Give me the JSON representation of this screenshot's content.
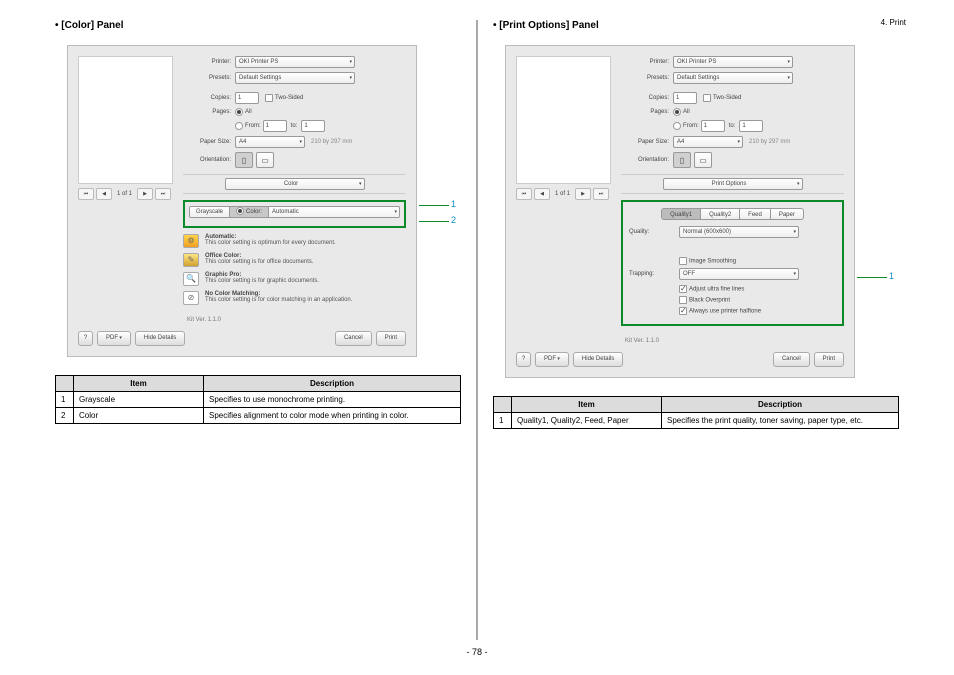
{
  "header": {
    "chapter": "4. Print"
  },
  "page_number": "- 78 -",
  "left": {
    "title": "[Color] Panel",
    "dialog": {
      "printer_label": "Printer:",
      "printer_value": "OKI Printer PS",
      "presets_label": "Presets:",
      "presets_value": "Default Settings",
      "copies_label": "Copies:",
      "copies_value": "1",
      "two_sided": "Two-Sided",
      "pages_label": "Pages:",
      "pages_all": "All",
      "pages_from": "From:",
      "pages_from_v": "1",
      "pages_to": "to:",
      "pages_to_v": "1",
      "paper_label": "Paper Size:",
      "paper_value": "A4",
      "paper_dim": "210 by 297 mm",
      "orient_label": "Orientation:",
      "nav_text": "1 of 1",
      "tab_value": "Color",
      "ct_grayscale": "Grayscale",
      "ct_color": "Color:",
      "ct_auto": "Automatic",
      "d1_t": "Automatic:",
      "d1_b": "This color setting is optimum for every document.",
      "d2_t": "Office Color:",
      "d2_b": "This color setting is for office documents.",
      "d3_t": "Graphic Pro:",
      "d3_b": "This color setting is for graphic documents.",
      "d4_t": "No Color Matching:",
      "d4_b": "This color setting is for color matching in an application.",
      "kit": "Kit Ver. 1.1.0",
      "help": "?",
      "pdf": "PDF",
      "hide": "Hide Details",
      "cancel": "Cancel",
      "print": "Print"
    },
    "callouts": {
      "c1": "1",
      "c2": "2"
    },
    "table": {
      "h_blank": "",
      "h_item": "Item",
      "h_desc": "Description",
      "rows": [
        {
          "n": "1",
          "item": "Grayscale",
          "desc": "Specifies to use monochrome printing."
        },
        {
          "n": "2",
          "item": "Color",
          "desc": "Specifies alignment to color mode when printing in color."
        }
      ]
    }
  },
  "right": {
    "title": "[Print Options] Panel",
    "dialog": {
      "printer_label": "Printer:",
      "printer_value": "OKI Printer PS",
      "presets_label": "Presets:",
      "presets_value": "Default Settings",
      "copies_label": "Copies:",
      "copies_value": "1",
      "two_sided": "Two-Sided",
      "pages_label": "Pages:",
      "pages_all": "All",
      "pages_from": "From:",
      "pages_from_v": "1",
      "pages_to": "to:",
      "pages_to_v": "1",
      "paper_label": "Paper Size:",
      "paper_value": "A4",
      "paper_dim": "210 by 297 mm",
      "orient_label": "Orientation:",
      "nav_text": "1 of 1",
      "tab_value": "Print Options",
      "po_tabs": {
        "q1": "Quality1",
        "q2": "Quality2",
        "feed": "Feed",
        "paper": "Paper"
      },
      "quality_label": "Quality:",
      "quality_value": "Normal (600x600)",
      "img_smooth": "Image Smoothing",
      "trapping_label": "Trapping:",
      "trapping_value": "OFF",
      "adj_fine": "Adjust ultra fine lines",
      "black_over": "Black Overprint",
      "use_halftone": "Always use printer halftone",
      "kit": "Kit Ver. 1.1.0",
      "help": "?",
      "pdf": "PDF",
      "hide": "Hide Details",
      "cancel": "Cancel",
      "print": "Print"
    },
    "callouts": {
      "c1": "1"
    },
    "table": {
      "h_blank": "",
      "h_item": "Item",
      "h_desc": "Description",
      "rows": [
        {
          "n": "1",
          "item": "Quality1, Quality2, Feed, Paper",
          "desc": "Specifies the print quality, toner saving, paper type, etc."
        }
      ]
    }
  }
}
